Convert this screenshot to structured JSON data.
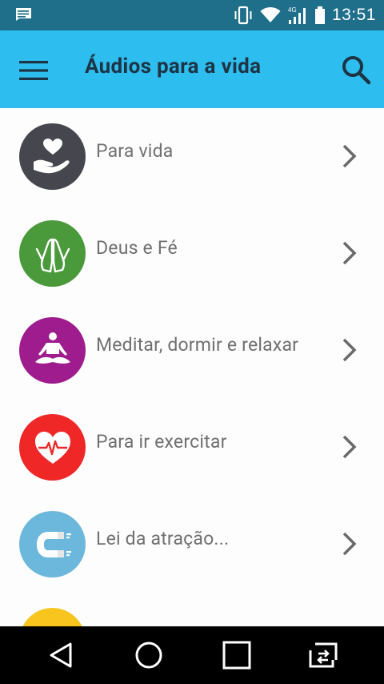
{
  "status_bar": {
    "time": "13:51",
    "network_label": "4G",
    "icons": [
      "message-icon",
      "vibrate-icon",
      "wifi-icon",
      "signal-icon",
      "battery-icon"
    ]
  },
  "app_bar": {
    "title": "Áudios para a vida",
    "icons": [
      "menu-icon",
      "search-icon"
    ]
  },
  "colors": {
    "status_bar": "#1f6f8b",
    "app_bar": "#2dbdef",
    "title_text": "#1e3444",
    "item_text": "#707070"
  },
  "categories": [
    {
      "label": "Para vida",
      "icon": "heart-hand-icon",
      "color": "#46464f"
    },
    {
      "label": "Deus e Fé",
      "icon": "praying-hands-icon",
      "color": "#4a9a3c"
    },
    {
      "label": "Meditar, dormir e relaxar",
      "icon": "meditation-icon",
      "color": "#9e1c8e"
    },
    {
      "label": "Para ir exercitar",
      "icon": "heartbeat-icon",
      "color": "#ef2727"
    },
    {
      "label": "Lei da atração...",
      "icon": "magnet-icon",
      "color": "#6cb8dc"
    },
    {
      "label": "",
      "icon": "partial-item-icon",
      "color": "#f7c51e"
    }
  ],
  "nav_bar": {
    "icons": [
      "back-icon",
      "home-icon",
      "recents-icon",
      "screen-switch-icon"
    ]
  }
}
